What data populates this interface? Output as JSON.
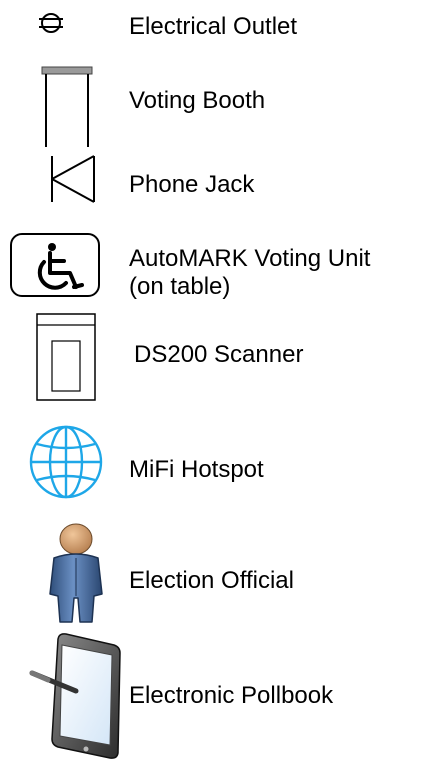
{
  "legend": {
    "items": [
      {
        "key": "electrical-outlet",
        "label": "Electrical Outlet",
        "icon": "electrical-outlet-icon"
      },
      {
        "key": "voting-booth",
        "label": "Voting Booth",
        "icon": "voting-booth-icon"
      },
      {
        "key": "phone-jack",
        "label": "Phone Jack",
        "icon": "phone-jack-icon"
      },
      {
        "key": "automark",
        "label_line1": "AutoMARK Voting Unit",
        "label_line2": "(on table)",
        "icon": "wheelchair-accessible-icon"
      },
      {
        "key": "ds200",
        "label": "DS200 Scanner",
        "icon": "ballot-scanner-icon"
      },
      {
        "key": "mifi",
        "label": "MiFi Hotspot",
        "icon": "globe-icon"
      },
      {
        "key": "official",
        "label": "Election Official",
        "icon": "person-icon"
      },
      {
        "key": "pollbook",
        "label": "Electronic Pollbook",
        "icon": "tablet-stylus-icon"
      }
    ]
  },
  "colors": {
    "text": "#000000",
    "line": "#000000",
    "globe": "#1ea7e8",
    "person_head": "#d9a371",
    "person_body": "#4a6fa0",
    "person_body_dark": "#2f4e7a",
    "tablet_screen": "#e9f2fb"
  }
}
